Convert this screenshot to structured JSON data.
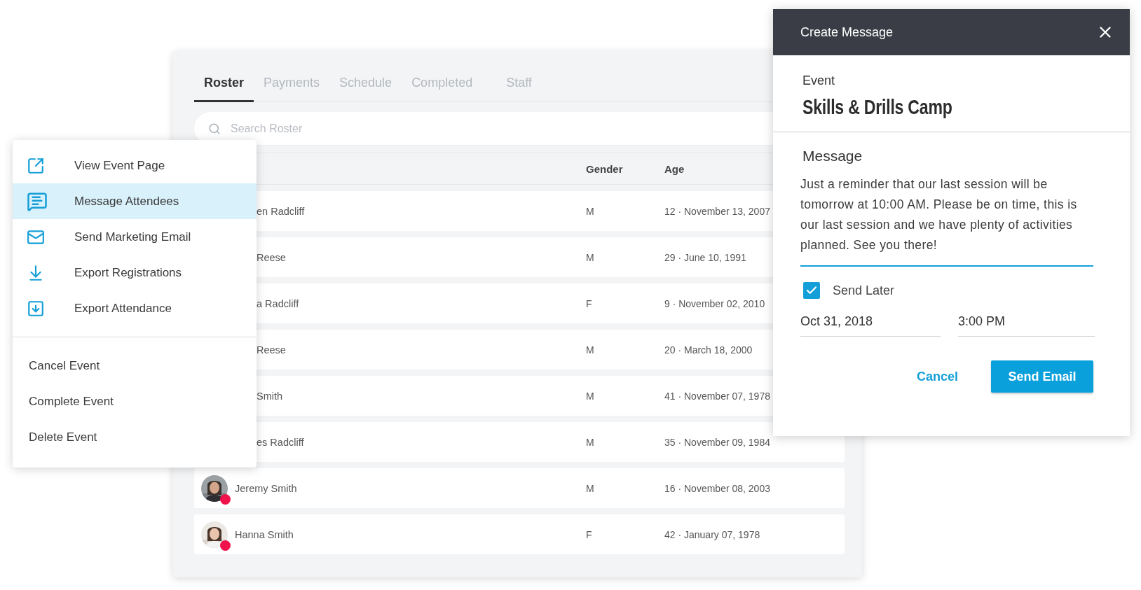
{
  "roster": {
    "tabs": [
      {
        "label": "Roster",
        "selected": true
      },
      {
        "label": "Payments",
        "selected": false
      },
      {
        "label": "Schedule",
        "selected": false
      },
      {
        "label": "Completed",
        "selected": false
      },
      {
        "label": "Staff",
        "selected": false
      }
    ],
    "search": {
      "placeholder": "Search Roster"
    },
    "columns": [
      "Gender",
      "Age"
    ],
    "rows": [
      {
        "name": "en Radcliff",
        "gender": "M",
        "age": "12 · November 13, 2007",
        "avatar": false
      },
      {
        "name": "Reese",
        "gender": "M",
        "age": "29 · June 10, 1991",
        "avatar": false
      },
      {
        "name": "a Radcliff",
        "gender": "F",
        "age": "9 · November 02, 2010",
        "avatar": false
      },
      {
        "name": "Reese",
        "gender": "M",
        "age": "20 · March 18, 2000",
        "avatar": false
      },
      {
        "name": "Smith",
        "gender": "M",
        "age": "41 · November 07, 1978",
        "avatar": false
      },
      {
        "name": "es Radcliff",
        "gender": "M",
        "age": "35 · November 09, 1984",
        "avatar": false
      },
      {
        "name": "Jeremy Smith",
        "gender": "M",
        "age": "16 · November 08, 2003",
        "avatar": true
      },
      {
        "name": "Hanna Smith",
        "gender": "F",
        "age": "42 · January 07, 1978",
        "avatar": true
      }
    ]
  },
  "menu": {
    "items": [
      {
        "label": "View Event Page",
        "selected": false
      },
      {
        "label": "Message Attendees",
        "selected": true
      },
      {
        "label": "Send Marketing Email",
        "selected": false
      },
      {
        "label": "Export Registrations",
        "selected": false
      },
      {
        "label": "Export Attendance",
        "selected": false
      }
    ],
    "event_actions": [
      {
        "label": "Cancel Event",
        "selected": false
      },
      {
        "label": "Complete Event",
        "selected": false
      },
      {
        "label": "Delete Event",
        "selected": false
      }
    ]
  },
  "modal": {
    "title": "Create Message",
    "event_label": "Event",
    "event_name": "Skills & Drills Camp",
    "message_label": "Message",
    "message": "Just a reminder that our last session will be tomorrow at 10:00 AM. Please be on time, this is our last session and we have plenty of activities planned. See you there!",
    "send_later": {
      "label": "Send Later",
      "checked": true
    },
    "date": "Oct 31, 2018",
    "time": "3:00 PM",
    "buttons": {
      "cancel": "Cancel",
      "send": "Send Email"
    }
  }
}
